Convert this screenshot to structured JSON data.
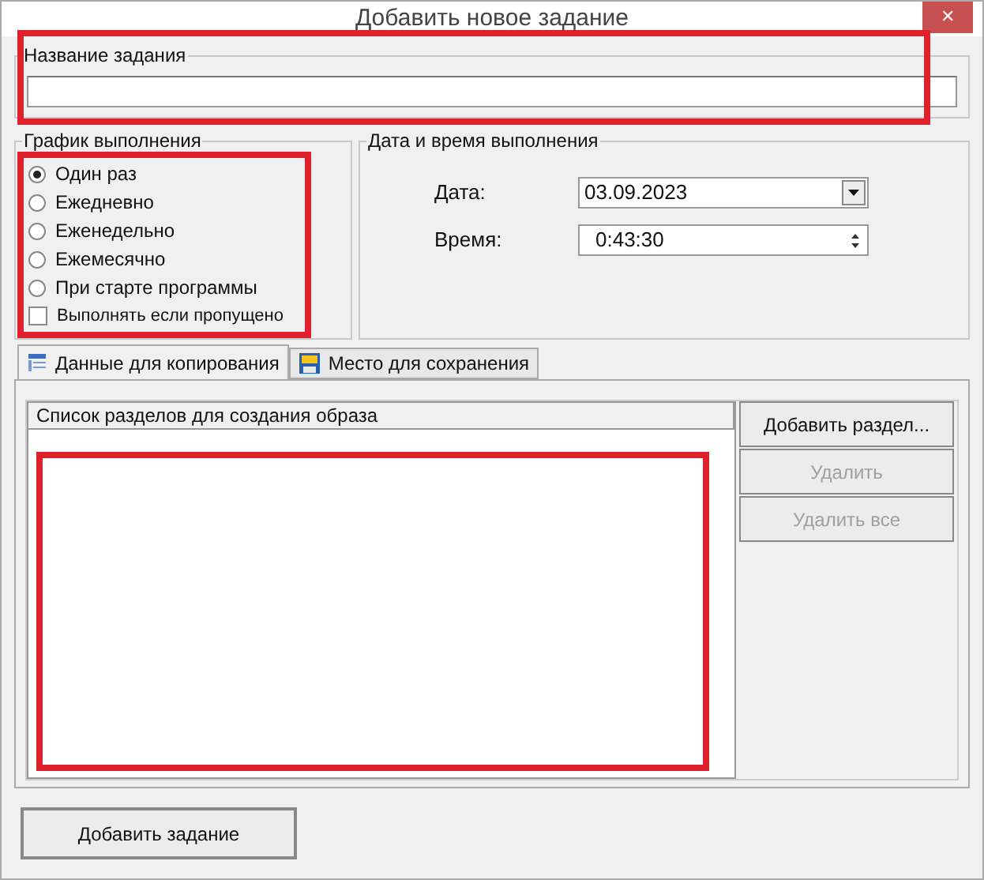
{
  "window": {
    "title": "Добавить новое задание",
    "close": "✕"
  },
  "name_group": {
    "label": "Название задания"
  },
  "schedule": {
    "label": "График выполнения",
    "options": [
      {
        "label": "Один раз",
        "selected": true
      },
      {
        "label": "Ежедневно",
        "selected": false
      },
      {
        "label": "Еженедельно",
        "selected": false
      },
      {
        "label": "Ежемесячно",
        "selected": false
      },
      {
        "label": "При старте программы",
        "selected": false
      }
    ],
    "missed": {
      "label": "Выполнять если пропущено",
      "checked": false
    }
  },
  "datetime": {
    "label": "Дата и время выполнения",
    "date": {
      "label": "Дата:",
      "value": "03.09.2023"
    },
    "time": {
      "label": "Время:",
      "value": "0:43:30"
    }
  },
  "tabs": [
    {
      "label": "Данные для копирования",
      "selected": true,
      "kind": "list"
    },
    {
      "label": "Место для сохранения",
      "selected": false,
      "kind": "disk"
    }
  ],
  "list": {
    "header": "Список разделов для создания образа"
  },
  "buttons": [
    {
      "label": "Добавить раздел...",
      "disabled": false
    },
    {
      "label": "Удалить",
      "disabled": true
    },
    {
      "label": "Удалить все",
      "disabled": true
    }
  ],
  "submit": {
    "label": "Добавить задание"
  }
}
